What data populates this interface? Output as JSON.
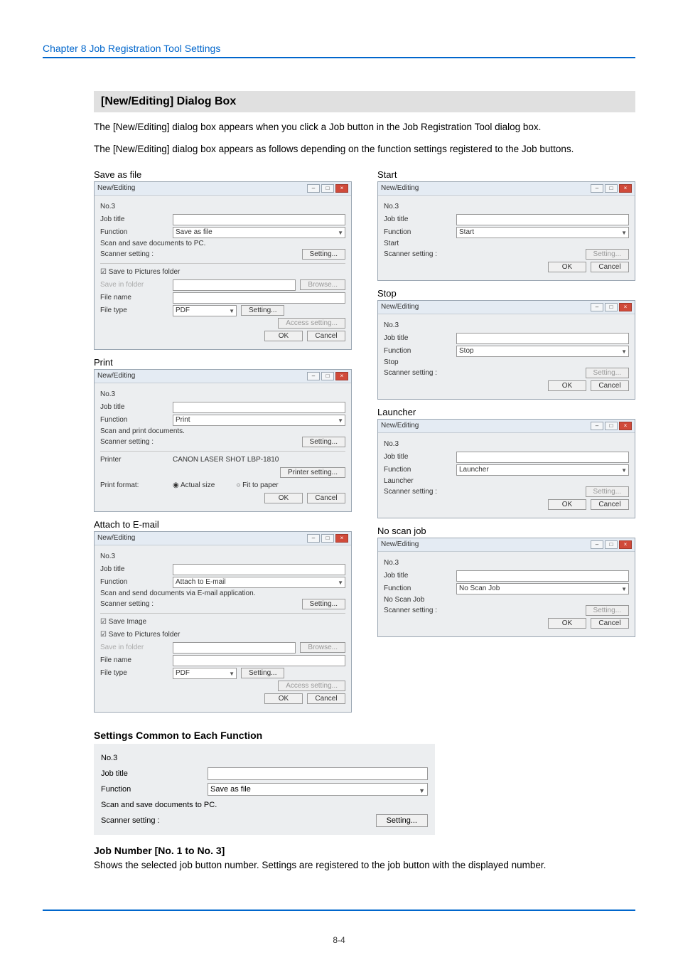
{
  "chapter": "Chapter 8   Job Registration Tool Settings",
  "section_title": "[New/Editing] Dialog Box",
  "para1": "The [New/Editing] dialog box appears when you click a Job button in the Job Registration Tool dialog box.",
  "para2": "The [New/Editing] dialog box appears as follows depending on the function settings registered to the Job buttons.",
  "labels": {
    "save_as_file": "Save as file",
    "start": "Start",
    "print": "Print",
    "stop": "Stop",
    "attach": "Attach to E-mail",
    "launcher": "Launcher",
    "noscan": "No scan job"
  },
  "dlg": {
    "title": "New/Editing",
    "no": "No.3",
    "job_title": "Job title",
    "function": "Function",
    "scanner_setting": "Scanner setting :",
    "setting_btn": "Setting...",
    "ok": "OK",
    "cancel": "Cancel",
    "browse": "Browse...",
    "save_in_folder": "Save in folder",
    "file_name": "File name",
    "file_type": "File type",
    "pdf": "PDF",
    "access_setting": "Access setting...",
    "save_to_pictures": "Save to Pictures folder",
    "save_image": "Save Image"
  },
  "save_as_file": {
    "func": "Save as file",
    "desc": "Scan and save documents to PC."
  },
  "print_dlg": {
    "func": "Print",
    "desc": "Scan and print documents.",
    "printer": "Printer",
    "printer_name": "CANON LASER SHOT LBP-1810",
    "printer_setting": "Printer setting...",
    "print_format": "Print format:",
    "actual": "Actual size",
    "fit": "Fit to paper"
  },
  "attach_dlg": {
    "func": "Attach to E-mail",
    "desc": "Scan and send documents via E-mail application."
  },
  "start_dlg": {
    "func": "Start",
    "desc": "Start"
  },
  "stop_dlg": {
    "func": "Stop",
    "desc": "Stop"
  },
  "launcher_dlg": {
    "func": "Launcher",
    "desc": "Launcher"
  },
  "noscan_dlg": {
    "func": "No Scan Job",
    "desc": "No Scan Job"
  },
  "common": {
    "heading": "Settings Common to Each Function",
    "no": "No.3",
    "job_title": "Job title",
    "function": "Function",
    "func_val": "Save as file",
    "desc": "Scan and save documents to PC.",
    "scanner": "Scanner setting :",
    "setting": "Setting..."
  },
  "jobnum": {
    "heading": "Job Number [No. 1 to No. 3]",
    "text": "Shows the selected job button number. Settings are registered to the job button with the displayed number."
  },
  "page_number": "8-4"
}
